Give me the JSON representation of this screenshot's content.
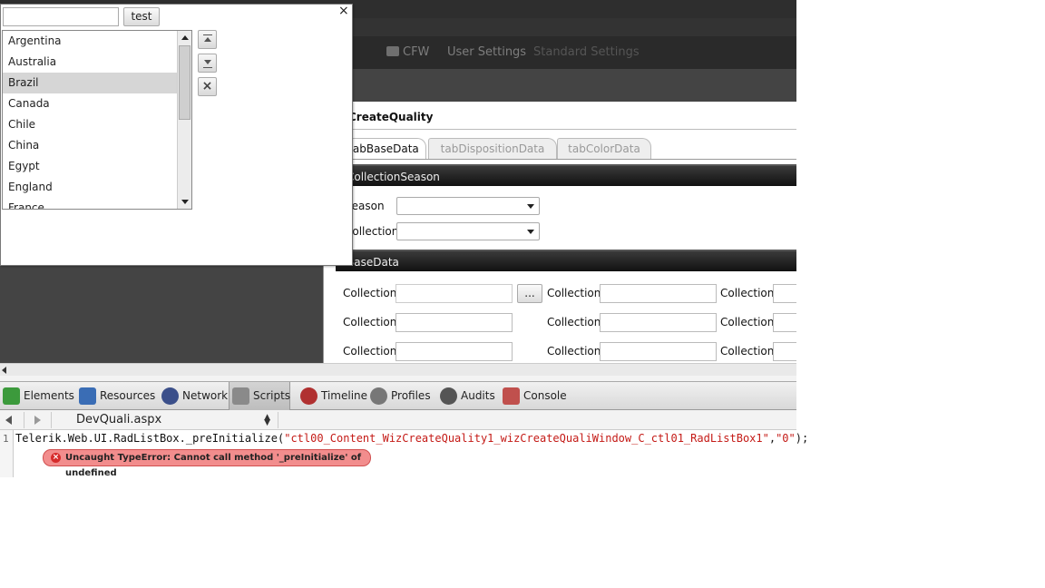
{
  "app": {
    "nav": [
      {
        "label": "CFW"
      },
      {
        "label": "User Settings"
      },
      {
        "label": "Standard Settings"
      }
    ],
    "page_title": "CreateQuality",
    "tabs": [
      {
        "label": "tabBaseData",
        "active": true
      },
      {
        "label": "tabDispositionData",
        "active": false
      },
      {
        "label": "tabColorData",
        "active": false
      }
    ],
    "sections": {
      "collection_season": "CollectionSeason",
      "base_data": "BaseData"
    },
    "season_label": "Season",
    "collection_label": "Collection",
    "grid_label": "Collection",
    "ellipsis_label": "..."
  },
  "popup": {
    "close_label": "×",
    "filter_value": "",
    "test_button": "test",
    "countries": [
      "Argentina",
      "Australia",
      "Brazil",
      "Canada",
      "Chile",
      "China",
      "Egypt",
      "England",
      "France"
    ],
    "selected": "Brazil"
  },
  "devtools": {
    "tabs": [
      {
        "label": "Elements",
        "color": "#3c9a3c"
      },
      {
        "label": "Resources",
        "color": "#3a6db5"
      },
      {
        "label": "Network",
        "color": "#3b4f8a"
      },
      {
        "label": "Scripts",
        "color": "#8a8a8a"
      },
      {
        "label": "Timeline",
        "color": "#b03030"
      },
      {
        "label": "Profiles",
        "color": "#777777"
      },
      {
        "label": "Audits",
        "color": "#555555"
      },
      {
        "label": "Console",
        "color": "#c0504d"
      }
    ],
    "active_tab": "Scripts",
    "file": "DevQuali.aspx",
    "line_number": "1",
    "code_prefix": "Telerik.Web.UI.RadListBox._preInitialize(",
    "code_arg1": "\"ctl00_Content_WizCreateQuality1_wizCreateQualiWindow_C_ctl01_RadListBox1\"",
    "code_comma": ",",
    "code_arg2": "\"0\"",
    "code_suffix": ");",
    "error_message": "Uncaught TypeError: Cannot call method '_preInitialize' of undefined"
  }
}
